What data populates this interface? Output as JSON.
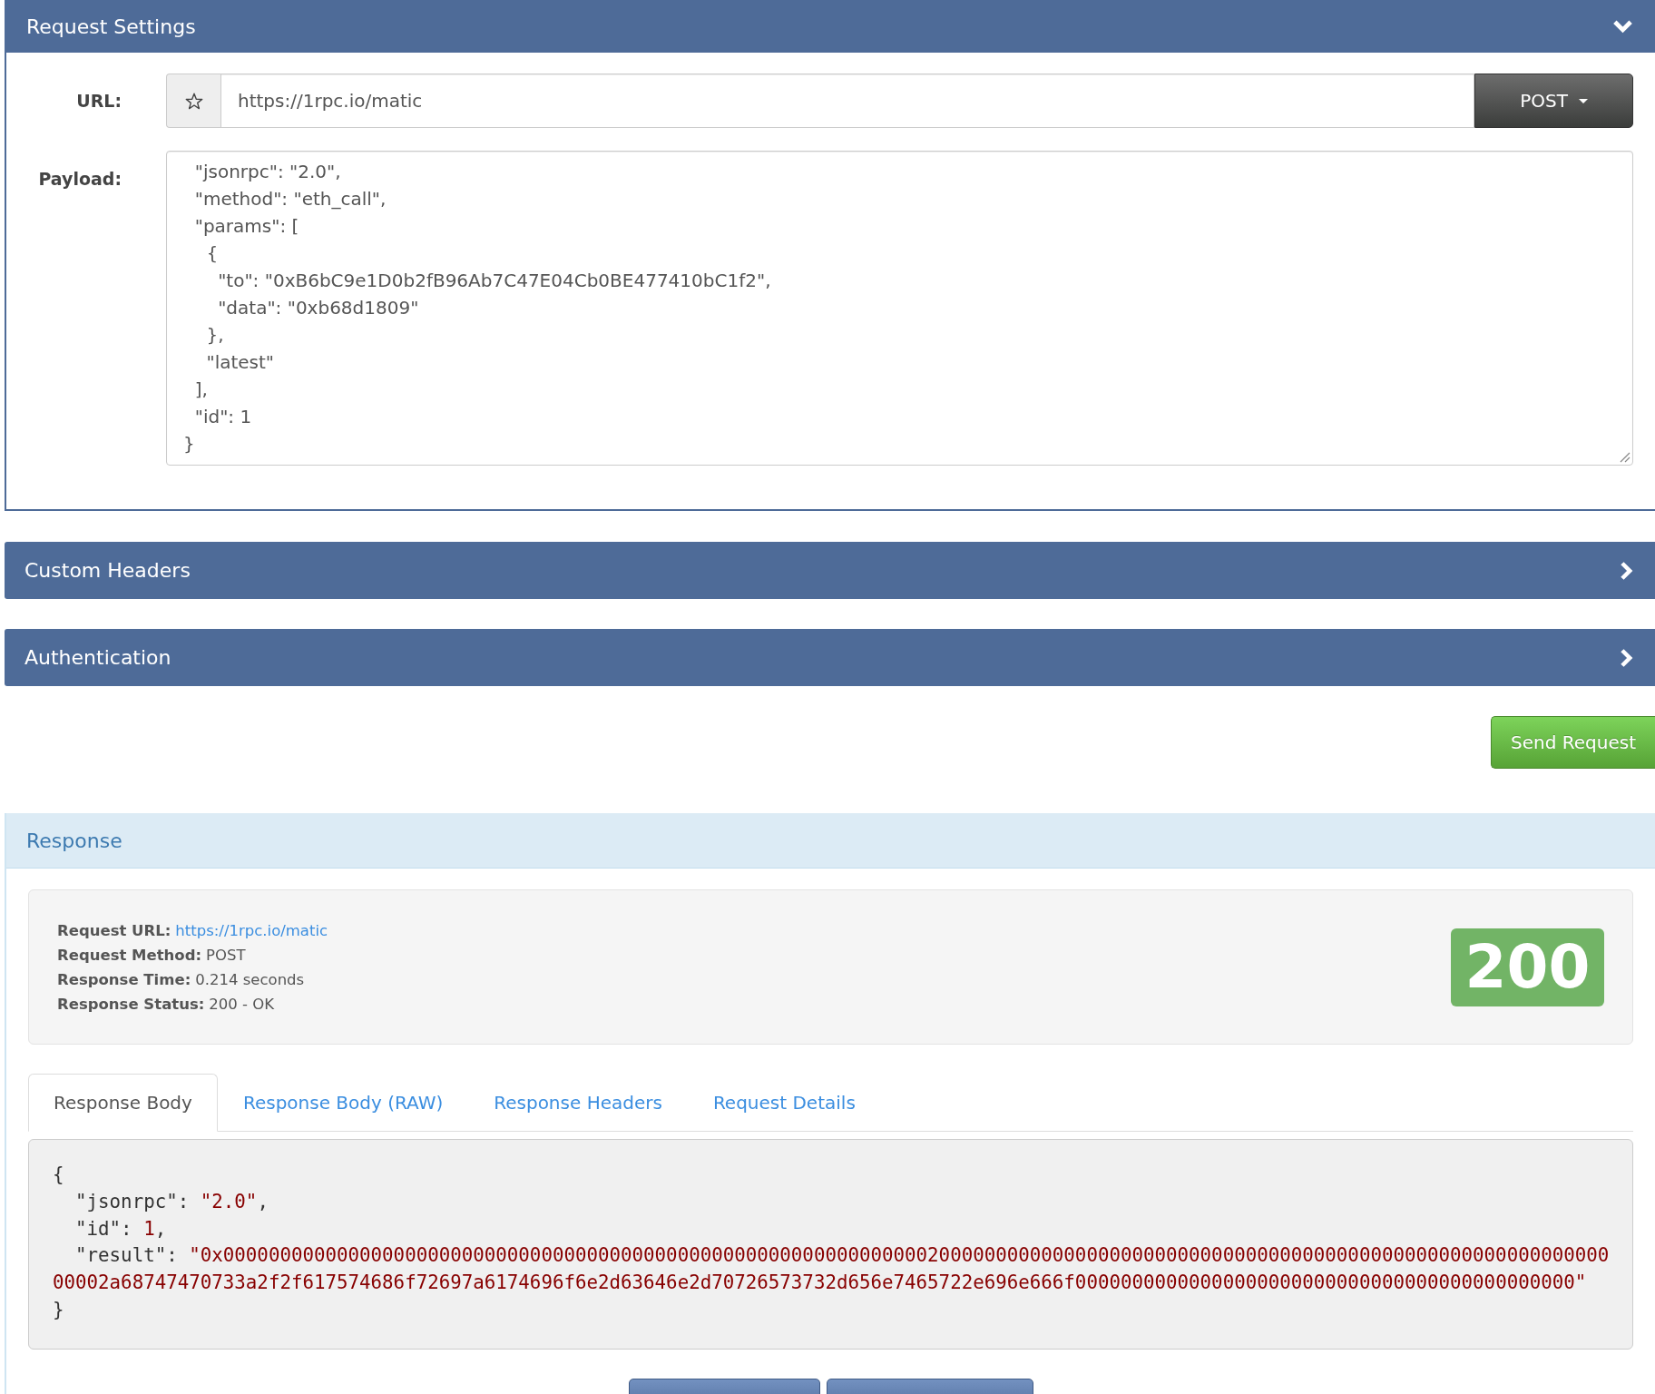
{
  "request_settings": {
    "title": "Request Settings",
    "expanded": true,
    "url_label": "URL:",
    "url": "https://1rpc.io/matic",
    "method": "POST",
    "payload_label": "Payload:",
    "payload": "  \"jsonrpc\": \"2.0\",\n  \"method\": \"eth_call\",\n  \"params\": [\n    {\n      \"to\": \"0xB6bC9e1D0b2fB96Ab7C47E04Cb0BE477410bC1f2\",\n      \"data\": \"0xb68d1809\"\n    },\n    \"latest\"\n  ],\n  \"id\": 1\n}"
  },
  "sections": [
    {
      "title": "Custom Headers",
      "expanded": false
    },
    {
      "title": "Authentication",
      "expanded": false
    }
  ],
  "send_button": "Send Request",
  "response": {
    "title": "Response",
    "info": [
      {
        "label": "Request URL:",
        "value": "https://1rpc.io/matic",
        "kind": "link"
      },
      {
        "label": "Request Method:",
        "value": "POST",
        "kind": "text"
      },
      {
        "label": "Response Time:",
        "value": "0.214 seconds",
        "kind": "text"
      },
      {
        "label": "Response Status:",
        "value": "200 - OK",
        "kind": "text"
      }
    ],
    "status_code": "200",
    "tabs": [
      {
        "label": "Response Body",
        "selected": true
      },
      {
        "label": "Response Body (RAW)",
        "selected": false
      },
      {
        "label": "Response Headers",
        "selected": false
      },
      {
        "label": "Request Details",
        "selected": false
      }
    ],
    "body": [
      {
        "kind": "brace",
        "text": "{"
      },
      {
        "kind": "pair",
        "key": "\"jsonrpc\":",
        "value": "\"2.0\"",
        "end": ","
      },
      {
        "kind": "pair",
        "key": "\"id\":",
        "value": "1",
        "end": ","
      },
      {
        "kind": "pair",
        "key": "\"result\":",
        "value": "\"0x0000000000000000000000000000000000000000000000000000000000000020000000000000000000000000000000000000000000000000000000000000002a68747470733a2f2f617574686f72697a6174696f6e2d63646e2d70726573732d656e7465722e696e666f00000000000000000000000000000000000000000000\""
      },
      {
        "kind": "brace",
        "text": "}"
      }
    ]
  }
}
